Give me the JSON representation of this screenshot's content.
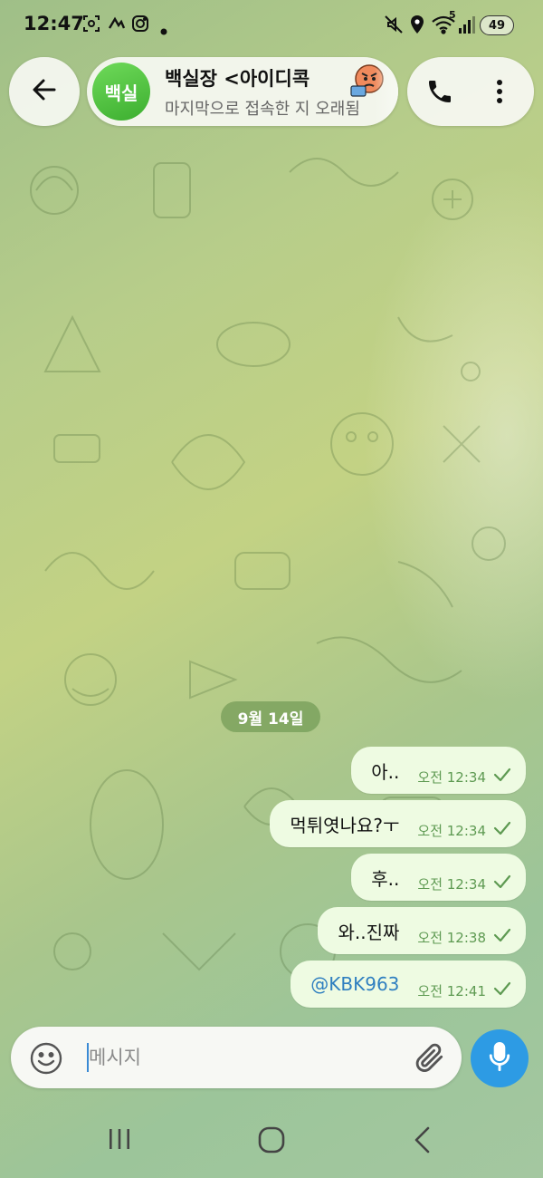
{
  "status_bar": {
    "time": "12:47",
    "battery": "49",
    "network_sup": "5"
  },
  "header": {
    "back_icon": "arrow-left-icon",
    "avatar_text": "백실",
    "title": "백실장 <아이디콕",
    "subtitle": "마지막으로 접속한 지 오래됨",
    "call_icon": "phone-icon",
    "more_icon": "more-vertical-icon"
  },
  "date_separator": "9월 14일",
  "messages": [
    {
      "text": "아..",
      "time": "오전 12:34",
      "status": "sent"
    },
    {
      "text": "먹튀엿나요?ㅜ",
      "time": "오전 12:34",
      "status": "sent"
    },
    {
      "text": "후..",
      "time": "오전 12:34",
      "status": "sent"
    },
    {
      "text": "와..진짜",
      "time": "오전 12:38",
      "status": "sent"
    },
    {
      "text": "@KBK963",
      "time": "오전 12:41",
      "status": "sent"
    }
  ],
  "composer": {
    "placeholder": "메시지",
    "emoji_icon": "smiley-icon",
    "attach_icon": "paperclip-icon",
    "mic_icon": "microphone-icon"
  },
  "colors": {
    "bubble": "#eefbe2",
    "accent": "#2d9be4",
    "avatar": "#4cc23a",
    "time": "#5e9a52",
    "mention": "#2f7fc0"
  },
  "nav_bar": {
    "recents_icon": "recents-icon",
    "home_icon": "home-icon",
    "back_icon": "back-chevron-icon"
  }
}
